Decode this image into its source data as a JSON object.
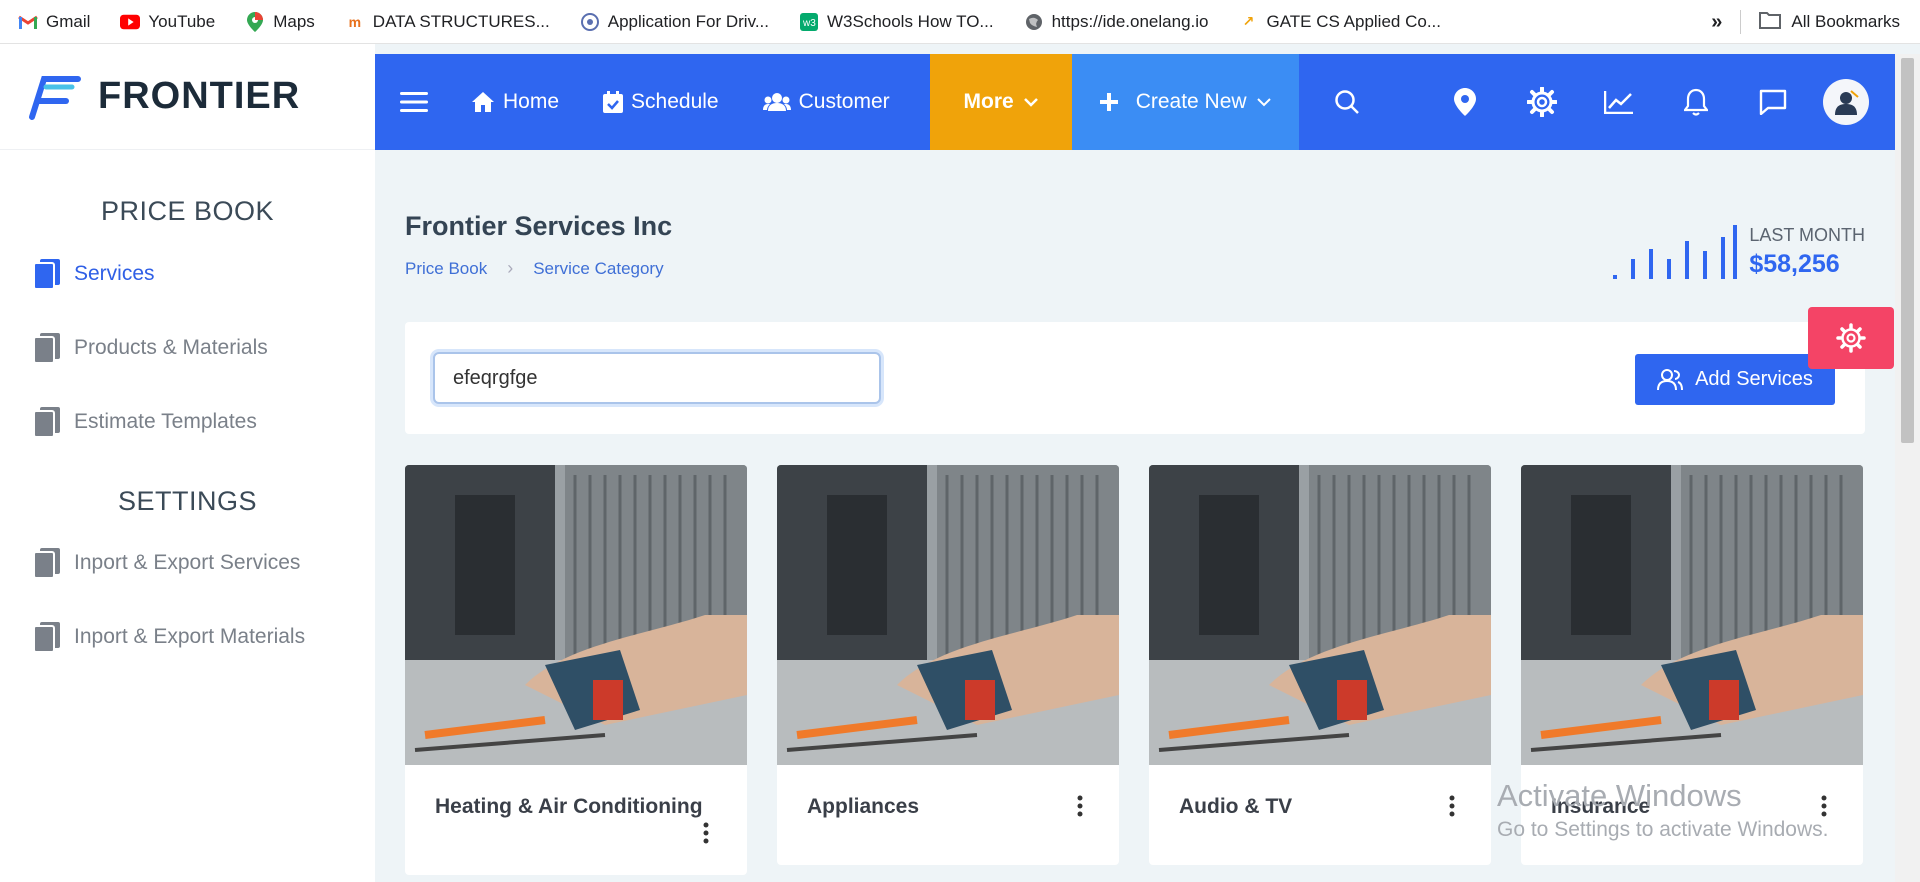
{
  "bookmarks": {
    "items": [
      {
        "label": "Gmail",
        "icon": "gmail-icon"
      },
      {
        "label": "YouTube",
        "icon": "youtube-icon"
      },
      {
        "label": "Maps",
        "icon": "maps-icon"
      },
      {
        "label": "DATA STRUCTURES...",
        "icon": "site-icon"
      },
      {
        "label": "Application For Driv...",
        "icon": "site-icon"
      },
      {
        "label": "W3Schools How TO...",
        "icon": "site-icon"
      },
      {
        "label": "https://ide.onelang.io",
        "icon": "globe-icon"
      },
      {
        "label": "GATE CS Applied Co...",
        "icon": "site-icon"
      }
    ],
    "all_bookmarks": "All Bookmarks"
  },
  "brand": {
    "name": "FRONTIER",
    "accent": "#2f66f0"
  },
  "sidebar": {
    "price_book_heading": "PRICE BOOK",
    "price_book_items": [
      "Services",
      "Products & Materials",
      "Estimate Templates"
    ],
    "settings_heading": "SETTINGS",
    "settings_items": [
      "Inport & Export Services",
      "Inport & Export Materials"
    ]
  },
  "nav": {
    "home": "Home",
    "schedule": "Schedule",
    "customer": "Customer",
    "more": "More",
    "create_new": "Create New"
  },
  "page": {
    "title": "Frontier Services Inc",
    "breadcrumb": [
      "Price Book",
      "Service Category"
    ],
    "stats_label": "LAST MONTH",
    "stats_value": "$58,256"
  },
  "search": {
    "value": "efeqrgfge"
  },
  "add_button": "Add Services",
  "categories": [
    {
      "title": "Heating & Air Conditioning"
    },
    {
      "title": "Appliances"
    },
    {
      "title": "Audio & TV"
    },
    {
      "title": "Insurance"
    }
  ],
  "watermark": {
    "line1": "Activate Windows",
    "line2": "Go to Settings to activate Windows."
  }
}
